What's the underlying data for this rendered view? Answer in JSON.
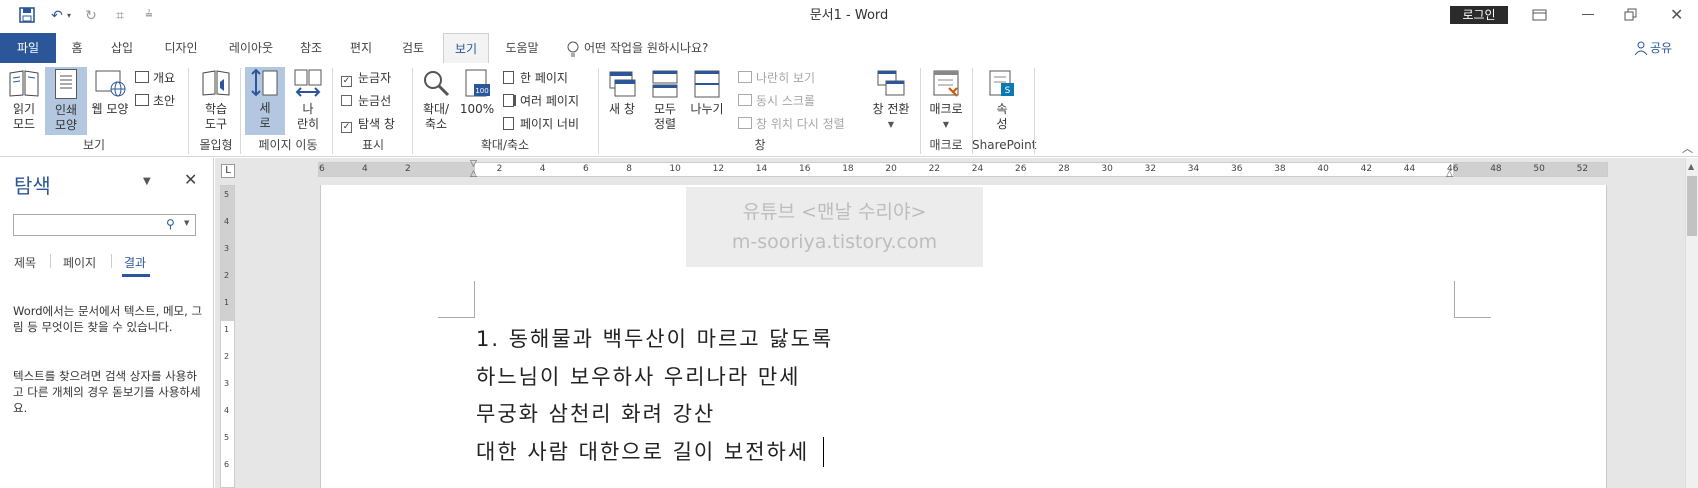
{
  "titlebar": {
    "title": "문서1  -  Word",
    "login": "로그인"
  },
  "tabs": [
    "파일",
    "홈",
    "삽입",
    "디자인",
    "레이아웃",
    "참조",
    "편지",
    "검토",
    "보기",
    "도움말"
  ],
  "tellme": "어떤 작업을 원하시나요?",
  "share": "공유",
  "ribbon": {
    "read_mode": "읽기\n모드",
    "print_layout": "인쇄\n모양",
    "web_layout": "웹 모양",
    "outline": "개요",
    "draft": "초안",
    "views_group": "보기",
    "learning_tools": "학습\n도구",
    "immersive_group": "몰입형",
    "vertical": "세\n로",
    "side_by_side": "나\n란히",
    "page_move_group": "페이지 이동",
    "ruler": "눈금자",
    "gridlines": "눈금선",
    "nav_pane": "탐색 창",
    "show_group": "표시",
    "zoom": "확대/\n축소",
    "zoom100": "100%",
    "one_page": "한 페이지",
    "multi_page": "여러 페이지",
    "page_width": "페이지 너비",
    "zoom_group": "확대/축소",
    "new_window": "새 창",
    "arrange_all": "모두\n정렬",
    "split": "나누기",
    "view_side": "나란히 보기",
    "sync_scroll": "동시 스크롤",
    "reset_window": "창 위치 다시 정렬",
    "switch_windows": "창 전환",
    "window_group": "창",
    "macros": "매크로",
    "macros_group": "매크로",
    "properties": "속\n성",
    "sharepoint_group": "SharePoint"
  },
  "nav": {
    "title": "탐색",
    "tabs": [
      "제목",
      "페이지",
      "결과"
    ],
    "desc1": "Word에서는 문서에서 텍스트, 메모, 그림 등 무엇이든 찾을 수 있습니다.",
    "desc2": "텍스트를 찾으려면 검색 상자를 사용하고 다른 개체의 경우 돋보기를 사용하세요."
  },
  "ruler": {
    "h_labels": [
      "6",
      "4",
      "2",
      "2",
      "4",
      "6",
      "8",
      "10",
      "12",
      "14",
      "16",
      "18",
      "20",
      "22",
      "24",
      "26",
      "28",
      "30",
      "32",
      "34",
      "36",
      "38",
      "40",
      "42",
      "44",
      "46",
      "48",
      "50",
      "52"
    ],
    "v_labels": [
      "5",
      "4",
      "3",
      "2",
      "1",
      "1",
      "2",
      "3",
      "4",
      "5",
      "6"
    ]
  },
  "watermark": {
    "line1": "유튜브 <맨날 수리야>",
    "line2": "m-sooriya.tistory.com"
  },
  "document": {
    "lines": [
      "1. 동해물과 백두산이 마르고 닳도록",
      "하느님이 보우하사 우리나라 만세",
      "무궁화 삼천리 화려 강산",
      "대한 사람 대한으로 길이 보전하세"
    ]
  }
}
